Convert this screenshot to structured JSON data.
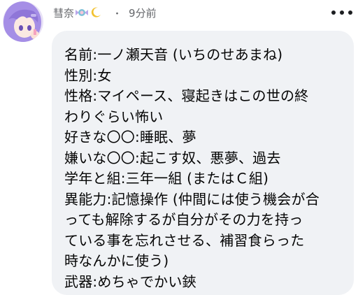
{
  "post": {
    "author": {
      "name": "彗奈",
      "decoration_icons": [
        "candy-icon",
        "crescent-moon-icon"
      ]
    },
    "separator": "・",
    "timestamp": "9分前",
    "menu_icon": "more-horizontal-icon"
  },
  "comment": {
    "lines": [
      "名前:一ノ瀬天音 (いちのせあまね)",
      "性別:女",
      "性格:マイペース、寝起きはこの世の終",
      "わりぐらい怖い",
      "好きな〇〇:睡眠、夢",
      "嫌いな〇〇:起こす奴、悪夢、過去",
      "学年と組:三年一組 (またはＣ組)",
      "異能力:記憶操作 (仲間には使う機会が合",
      "っても解除するが自分がその力を持っ",
      "ている事を忘れさせる、補習食らった",
      "時なんかに使う)",
      "武器:めちゃでかい鋏"
    ]
  },
  "colors": {
    "bubble_background": "#f0f2f5",
    "meta_text": "#65676b",
    "body_text": "#050505",
    "avatar_hair": "#a58ee6"
  }
}
